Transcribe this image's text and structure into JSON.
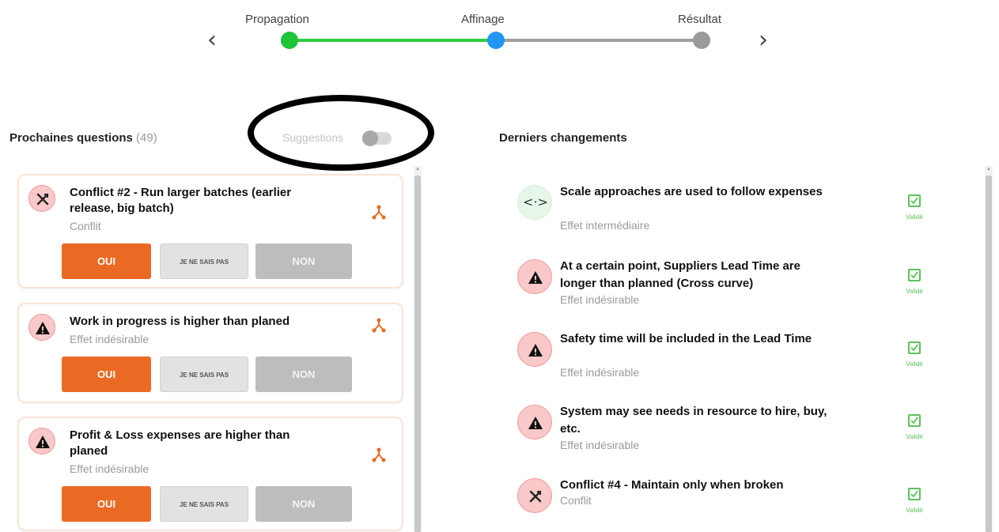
{
  "stepper": {
    "steps": [
      {
        "label": "Propagation",
        "state": "done",
        "color": "#1ec337"
      },
      {
        "label": "Affinage",
        "state": "current",
        "color": "#2196f3"
      },
      {
        "label": "Résultat",
        "state": "pending",
        "color": "#9a9a9a"
      }
    ],
    "prev_icon": "chevron-left-icon",
    "next_icon": "chevron-right-icon"
  },
  "questions": {
    "title": "Prochaines questions",
    "count": "(49)",
    "suggestions_label": "Suggestions",
    "suggestions_on": false,
    "buttons": {
      "yes": "OUI",
      "unknown": "JE NE SAIS PAS",
      "no": "NON"
    },
    "items": [
      {
        "title": "Conflict #2 - Run larger batches (earlier release, big batch)",
        "type": "Conflit",
        "icon": "conflict-icon"
      },
      {
        "title": "Work in progress is higher than planed",
        "type": "Effet indésirable",
        "icon": "warning-icon"
      },
      {
        "title": "Profit & Loss expenses are higher than planed",
        "type": "Effet indésirable",
        "icon": "warning-icon"
      }
    ]
  },
  "changes": {
    "title": "Derniers changements",
    "status_label": "Validé",
    "items": [
      {
        "title": "Scale approaches are used to follow expenses",
        "type": "Effet intermédiaire",
        "icon": "arrows-horizontal-icon",
        "arrows": "<·>"
      },
      {
        "title": "At a certain point, Suppliers Lead Time are longer than planned (Cross curve)",
        "type": "Effet indésirable",
        "icon": "warning-icon"
      },
      {
        "title": "Safety time will be included in the Lead Time",
        "type": "Effet indésirable",
        "icon": "warning-icon"
      },
      {
        "title": "System may see needs in resource to hire, buy, etc.",
        "type": "Effet indésirable",
        "icon": "warning-icon"
      },
      {
        "title": "Conflict #4 - Maintain only when broken",
        "type": "Conflit",
        "icon": "conflict-icon"
      }
    ]
  },
  "colors": {
    "accent_orange": "#ea6a23",
    "success_green": "#5cc15a",
    "conflict_pink": "#f9c8c8"
  }
}
